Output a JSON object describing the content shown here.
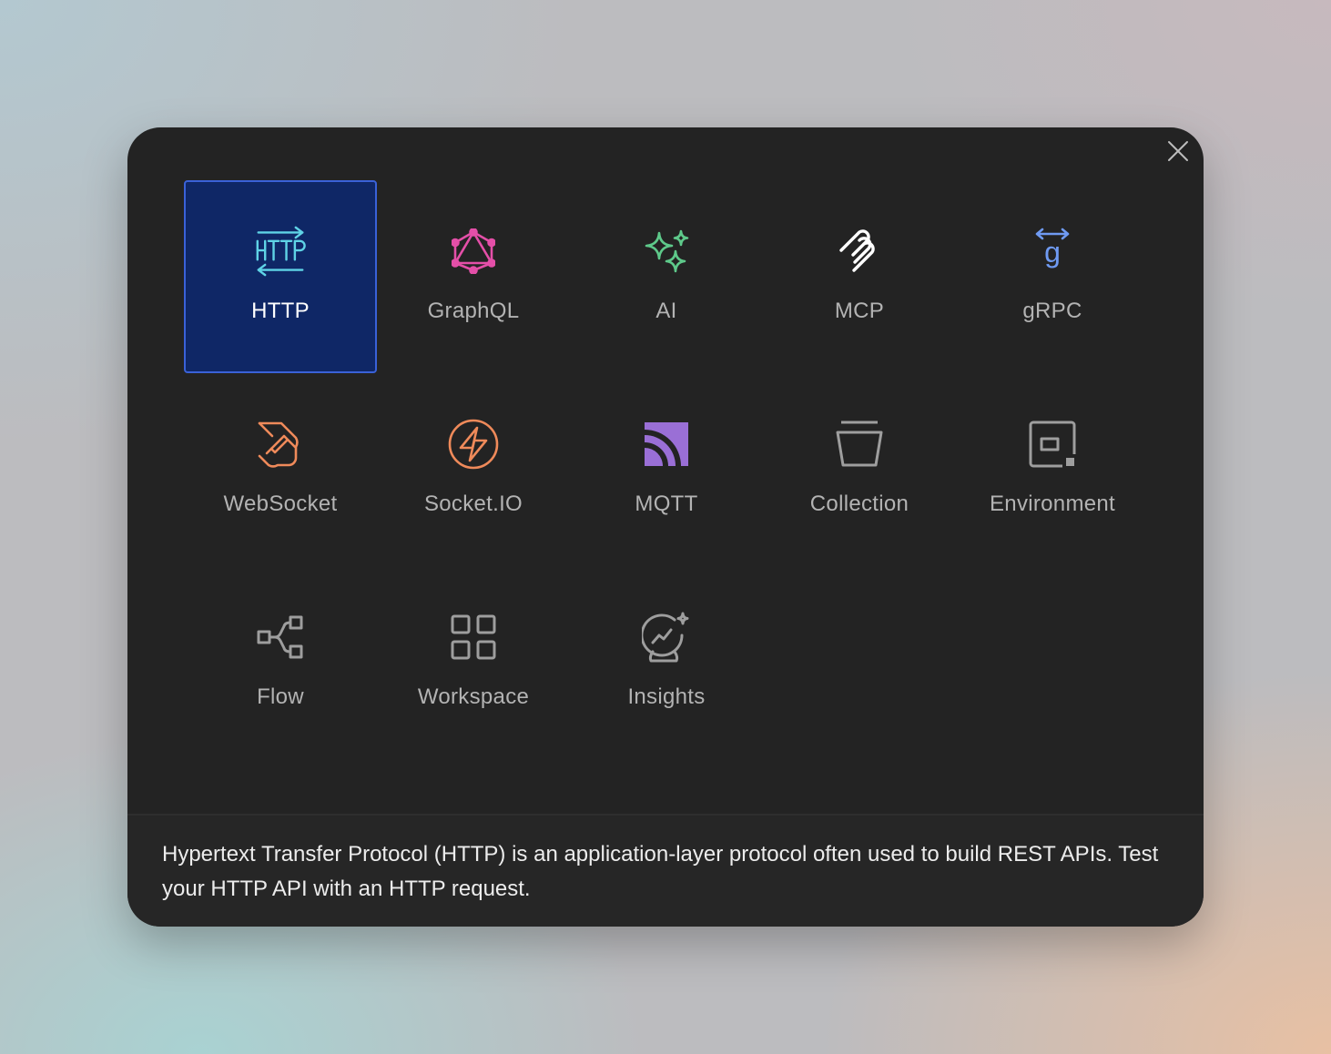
{
  "modal": {
    "tiles": [
      {
        "label": "HTTP",
        "icon": "http-icon",
        "color": "#5fd3e6",
        "selected": true
      },
      {
        "label": "GraphQL",
        "icon": "graphql-icon",
        "color": "#e44fa8"
      },
      {
        "label": "AI",
        "icon": "ai-sparkles-icon",
        "color": "#5ec98a"
      },
      {
        "label": "MCP",
        "icon": "mcp-icon",
        "color": "#ffffff"
      },
      {
        "label": "gRPC",
        "icon": "grpc-icon",
        "color": "#6f9af2"
      },
      {
        "label": "WebSocket",
        "icon": "websocket-icon",
        "color": "#ef8a5a"
      },
      {
        "label": "Socket.IO",
        "icon": "socketio-icon",
        "color": "#ef8a5a"
      },
      {
        "label": "MQTT",
        "icon": "mqtt-icon",
        "color": "#9a6fd6"
      },
      {
        "label": "Collection",
        "icon": "collection-icon",
        "color": "#9e9e9e"
      },
      {
        "label": "Environment",
        "icon": "environment-icon",
        "color": "#9e9e9e"
      },
      {
        "label": "Flow",
        "icon": "flow-icon",
        "color": "#9e9e9e"
      },
      {
        "label": "Workspace",
        "icon": "workspace-icon",
        "color": "#9e9e9e"
      },
      {
        "label": "Insights",
        "icon": "insights-icon",
        "color": "#9e9e9e"
      }
    ],
    "description": "Hypertext Transfer Protocol (HTTP) is an application-layer protocol often used to build REST APIs. Test your HTTP API with an HTTP request."
  }
}
